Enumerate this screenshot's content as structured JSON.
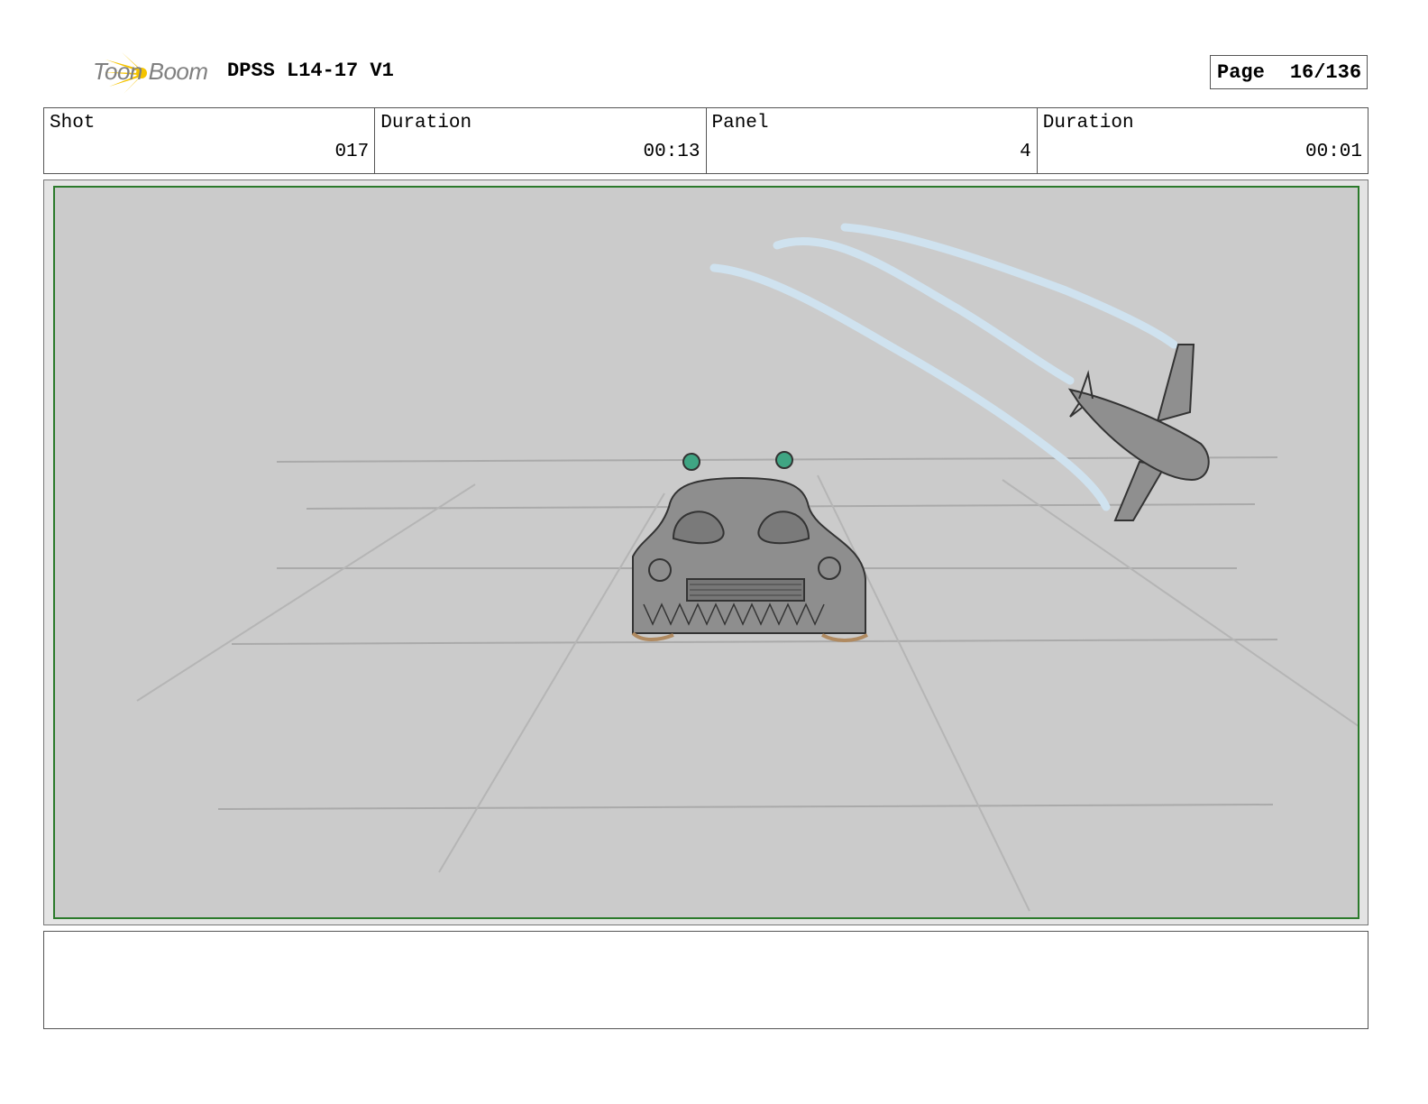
{
  "header": {
    "logo_text": "Toon Boom",
    "project_title": "DPSS L14-17 V1",
    "page_label": "Page",
    "page_value": "16/136"
  },
  "info": [
    {
      "label": "Shot",
      "value": "017"
    },
    {
      "label": "Duration",
      "value": "00:13"
    },
    {
      "label": "Panel",
      "value": "4"
    },
    {
      "label": "Duration",
      "value": "00:01"
    }
  ],
  "panel": {
    "frame_color": "#2b7a2b",
    "background_color": "#cbcbcb",
    "content": [
      "monster-car-sketch",
      "diving-plane-sketch",
      "smoke-trails",
      "perspective-grid"
    ]
  },
  "notes": {
    "text": ""
  }
}
